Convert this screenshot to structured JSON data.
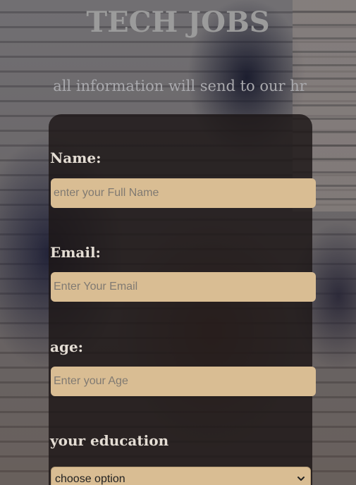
{
  "header": {
    "title": "TECH JOBS",
    "subtitle": "all information will send to our hr"
  },
  "form": {
    "name_label": "Name:",
    "name_placeholder": "enter your Full Name",
    "email_label": "Email:",
    "email_placeholder": "Enter Your Email",
    "age_label": "age:",
    "age_placeholder": "Enter your Age",
    "education_label": "your education",
    "education_selected": "choose option"
  },
  "colors": {
    "panel": "#1c1616",
    "input_fill": "#d9bd93",
    "label_text": "#e4ddd4",
    "title_text": "#9b9b9b"
  }
}
